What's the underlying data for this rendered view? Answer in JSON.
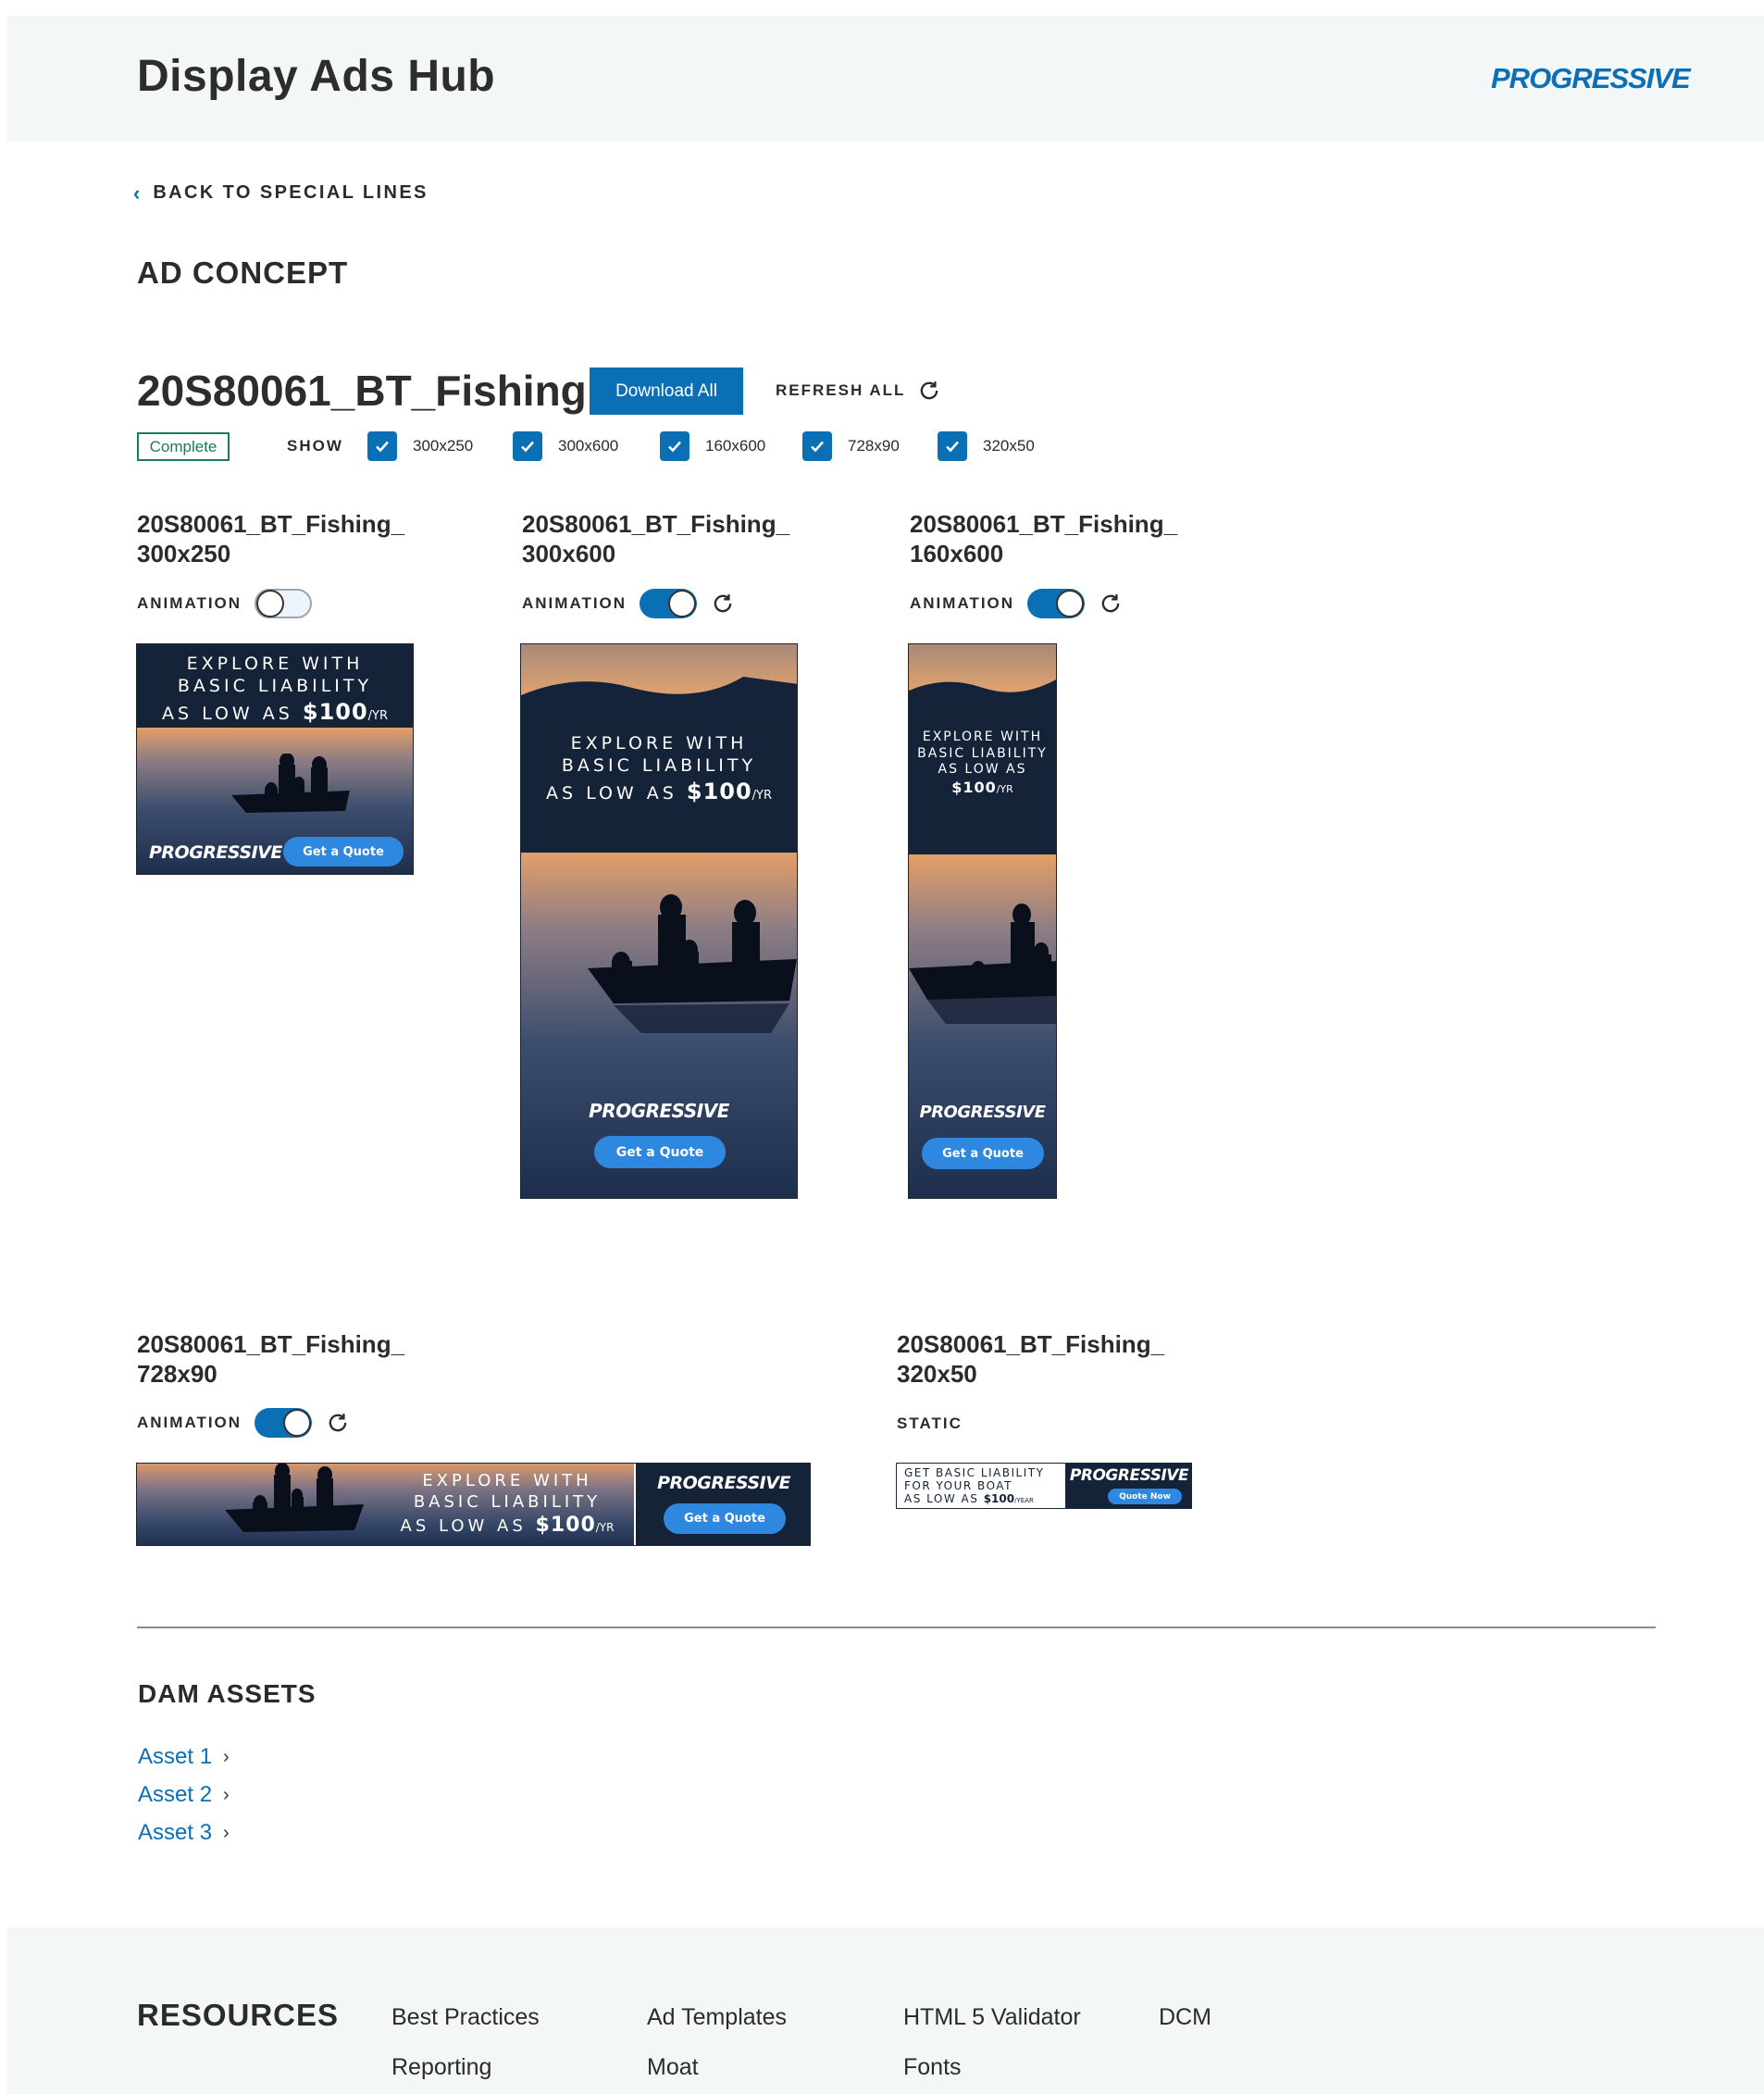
{
  "header": {
    "title": "Display Ads Hub",
    "logo_text": "PROGRESSIVE"
  },
  "nav": {
    "back_label": "BACK TO SPECIAL LINES"
  },
  "section_title": "AD CONCEPT",
  "concept": {
    "name": "20S80061_BT_Fishing",
    "download_all_label": "Download All",
    "refresh_all_label": "REFRESH ALL",
    "status": "Complete",
    "show_label": "SHOW",
    "sizes": [
      {
        "label": "300x250",
        "checked": true
      },
      {
        "label": "300x600",
        "checked": true
      },
      {
        "label": "160x600",
        "checked": true
      },
      {
        "label": "728x90",
        "checked": true
      },
      {
        "label": "320x50",
        "checked": true
      }
    ]
  },
  "ads": [
    {
      "name_line1": "20S80061_BT_Fishing_",
      "name_line2": "300x250",
      "mode_label": "ANIMATION",
      "animation_on": false
    },
    {
      "name_line1": "20S80061_BT_Fishing_",
      "name_line2": "300x600",
      "mode_label": "ANIMATION",
      "animation_on": true
    },
    {
      "name_line1": "20S80061_BT_Fishing_",
      "name_line2": "160x600",
      "mode_label": "ANIMATION",
      "animation_on": true
    },
    {
      "name_line1": "20S80061_BT_Fishing_",
      "name_line2": "728x90",
      "mode_label": "ANIMATION",
      "animation_on": true
    },
    {
      "name_line1": "20S80061_BT_Fishing_",
      "name_line2": "320x50",
      "mode_label": "STATIC"
    }
  ],
  "creative": {
    "line1": "EXPLORE WITH",
    "line2": "BASIC LIABILITY",
    "line3_prefix": "AS LOW AS",
    "price": "$100",
    "price_suffix": "/YR",
    "cta": "Get a Quote",
    "logo": "PROGRESSIVE",
    "small_line1": "GET BASIC LIABILITY",
    "small_line2": "FOR YOUR BOAT",
    "small_line3_prefix": "AS LOW AS",
    "small_price": "$100",
    "small_price_suffix": "/YEAR",
    "small_cta": "Quote Now"
  },
  "dam": {
    "title": "DAM ASSETS",
    "assets": [
      "Asset 1",
      "Asset 2",
      "Asset 3"
    ]
  },
  "footer": {
    "title": "RESOURCES",
    "links": [
      "Best Practices",
      "Ad Templates",
      "HTML 5 Validator",
      "DCM",
      "Reporting",
      "Moat",
      "Fonts"
    ]
  },
  "colors": {
    "brand_blue": "#0b6fb5",
    "cta_blue": "#2e88e0",
    "complete_green": "#1a7a5a",
    "header_bg": "#f3f7f7"
  },
  "icons": [
    "chevron-left-icon",
    "refresh-icon",
    "checkmark-icon",
    "chevron-right-icon"
  ]
}
